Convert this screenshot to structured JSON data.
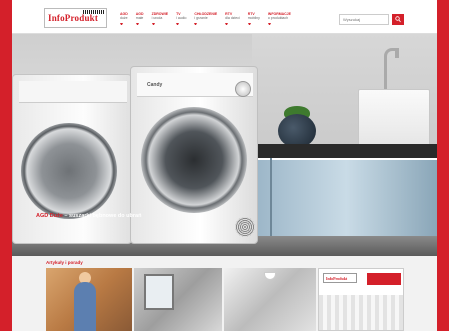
{
  "brand": {
    "logo_text": "InfoProdukt",
    "accent": "#d4202a"
  },
  "nav": {
    "items": [
      {
        "top": "AGD",
        "bottom": "duże"
      },
      {
        "top": "AGD",
        "bottom": "małe"
      },
      {
        "top": "ZDROWIE",
        "bottom": "i uroda"
      },
      {
        "top": "TV",
        "bottom": "i audio"
      },
      {
        "top": "CHŁODZENIE",
        "bottom": "i grzanie"
      },
      {
        "top": "RTV",
        "bottom": "dla dzieci"
      },
      {
        "top": "RTV",
        "bottom": "mobilny"
      },
      {
        "top": "INFORMACJE",
        "bottom": "o produktach"
      }
    ]
  },
  "search": {
    "placeholder": "Wyszukaj"
  },
  "hero": {
    "caption_brand": "AGD Duże",
    "caption_text": " – suszarki bębnowe do ubrań",
    "dryer_brand": "Candy"
  },
  "articles": {
    "title": "Artykuły i porady",
    "items": [
      {
        "name": "article-family"
      },
      {
        "name": "article-interior"
      },
      {
        "name": "article-kitchen"
      },
      {
        "name": "article-magazine",
        "logo": "InfoProdukt"
      }
    ]
  }
}
